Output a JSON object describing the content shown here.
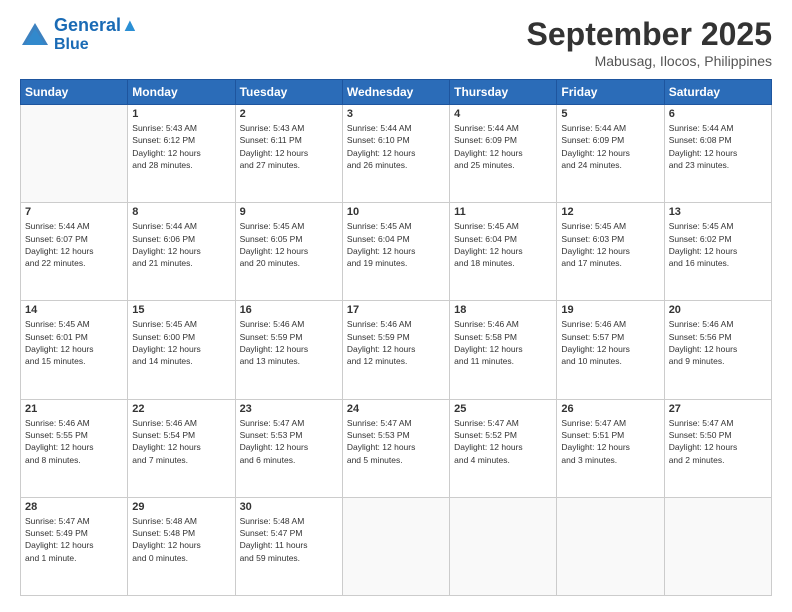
{
  "header": {
    "logo_line1": "General",
    "logo_line2": "Blue",
    "month": "September 2025",
    "location": "Mabusag, Ilocos, Philippines"
  },
  "weekdays": [
    "Sunday",
    "Monday",
    "Tuesday",
    "Wednesday",
    "Thursday",
    "Friday",
    "Saturday"
  ],
  "weeks": [
    [
      {
        "day": "",
        "info": ""
      },
      {
        "day": "1",
        "info": "Sunrise: 5:43 AM\nSunset: 6:12 PM\nDaylight: 12 hours\nand 28 minutes."
      },
      {
        "day": "2",
        "info": "Sunrise: 5:43 AM\nSunset: 6:11 PM\nDaylight: 12 hours\nand 27 minutes."
      },
      {
        "day": "3",
        "info": "Sunrise: 5:44 AM\nSunset: 6:10 PM\nDaylight: 12 hours\nand 26 minutes."
      },
      {
        "day": "4",
        "info": "Sunrise: 5:44 AM\nSunset: 6:09 PM\nDaylight: 12 hours\nand 25 minutes."
      },
      {
        "day": "5",
        "info": "Sunrise: 5:44 AM\nSunset: 6:09 PM\nDaylight: 12 hours\nand 24 minutes."
      },
      {
        "day": "6",
        "info": "Sunrise: 5:44 AM\nSunset: 6:08 PM\nDaylight: 12 hours\nand 23 minutes."
      }
    ],
    [
      {
        "day": "7",
        "info": "Sunrise: 5:44 AM\nSunset: 6:07 PM\nDaylight: 12 hours\nand 22 minutes."
      },
      {
        "day": "8",
        "info": "Sunrise: 5:44 AM\nSunset: 6:06 PM\nDaylight: 12 hours\nand 21 minutes."
      },
      {
        "day": "9",
        "info": "Sunrise: 5:45 AM\nSunset: 6:05 PM\nDaylight: 12 hours\nand 20 minutes."
      },
      {
        "day": "10",
        "info": "Sunrise: 5:45 AM\nSunset: 6:04 PM\nDaylight: 12 hours\nand 19 minutes."
      },
      {
        "day": "11",
        "info": "Sunrise: 5:45 AM\nSunset: 6:04 PM\nDaylight: 12 hours\nand 18 minutes."
      },
      {
        "day": "12",
        "info": "Sunrise: 5:45 AM\nSunset: 6:03 PM\nDaylight: 12 hours\nand 17 minutes."
      },
      {
        "day": "13",
        "info": "Sunrise: 5:45 AM\nSunset: 6:02 PM\nDaylight: 12 hours\nand 16 minutes."
      }
    ],
    [
      {
        "day": "14",
        "info": "Sunrise: 5:45 AM\nSunset: 6:01 PM\nDaylight: 12 hours\nand 15 minutes."
      },
      {
        "day": "15",
        "info": "Sunrise: 5:45 AM\nSunset: 6:00 PM\nDaylight: 12 hours\nand 14 minutes."
      },
      {
        "day": "16",
        "info": "Sunrise: 5:46 AM\nSunset: 5:59 PM\nDaylight: 12 hours\nand 13 minutes."
      },
      {
        "day": "17",
        "info": "Sunrise: 5:46 AM\nSunset: 5:59 PM\nDaylight: 12 hours\nand 12 minutes."
      },
      {
        "day": "18",
        "info": "Sunrise: 5:46 AM\nSunset: 5:58 PM\nDaylight: 12 hours\nand 11 minutes."
      },
      {
        "day": "19",
        "info": "Sunrise: 5:46 AM\nSunset: 5:57 PM\nDaylight: 12 hours\nand 10 minutes."
      },
      {
        "day": "20",
        "info": "Sunrise: 5:46 AM\nSunset: 5:56 PM\nDaylight: 12 hours\nand 9 minutes."
      }
    ],
    [
      {
        "day": "21",
        "info": "Sunrise: 5:46 AM\nSunset: 5:55 PM\nDaylight: 12 hours\nand 8 minutes."
      },
      {
        "day": "22",
        "info": "Sunrise: 5:46 AM\nSunset: 5:54 PM\nDaylight: 12 hours\nand 7 minutes."
      },
      {
        "day": "23",
        "info": "Sunrise: 5:47 AM\nSunset: 5:53 PM\nDaylight: 12 hours\nand 6 minutes."
      },
      {
        "day": "24",
        "info": "Sunrise: 5:47 AM\nSunset: 5:53 PM\nDaylight: 12 hours\nand 5 minutes."
      },
      {
        "day": "25",
        "info": "Sunrise: 5:47 AM\nSunset: 5:52 PM\nDaylight: 12 hours\nand 4 minutes."
      },
      {
        "day": "26",
        "info": "Sunrise: 5:47 AM\nSunset: 5:51 PM\nDaylight: 12 hours\nand 3 minutes."
      },
      {
        "day": "27",
        "info": "Sunrise: 5:47 AM\nSunset: 5:50 PM\nDaylight: 12 hours\nand 2 minutes."
      }
    ],
    [
      {
        "day": "28",
        "info": "Sunrise: 5:47 AM\nSunset: 5:49 PM\nDaylight: 12 hours\nand 1 minute."
      },
      {
        "day": "29",
        "info": "Sunrise: 5:48 AM\nSunset: 5:48 PM\nDaylight: 12 hours\nand 0 minutes."
      },
      {
        "day": "30",
        "info": "Sunrise: 5:48 AM\nSunset: 5:47 PM\nDaylight: 11 hours\nand 59 minutes."
      },
      {
        "day": "",
        "info": ""
      },
      {
        "day": "",
        "info": ""
      },
      {
        "day": "",
        "info": ""
      },
      {
        "day": "",
        "info": ""
      }
    ]
  ]
}
